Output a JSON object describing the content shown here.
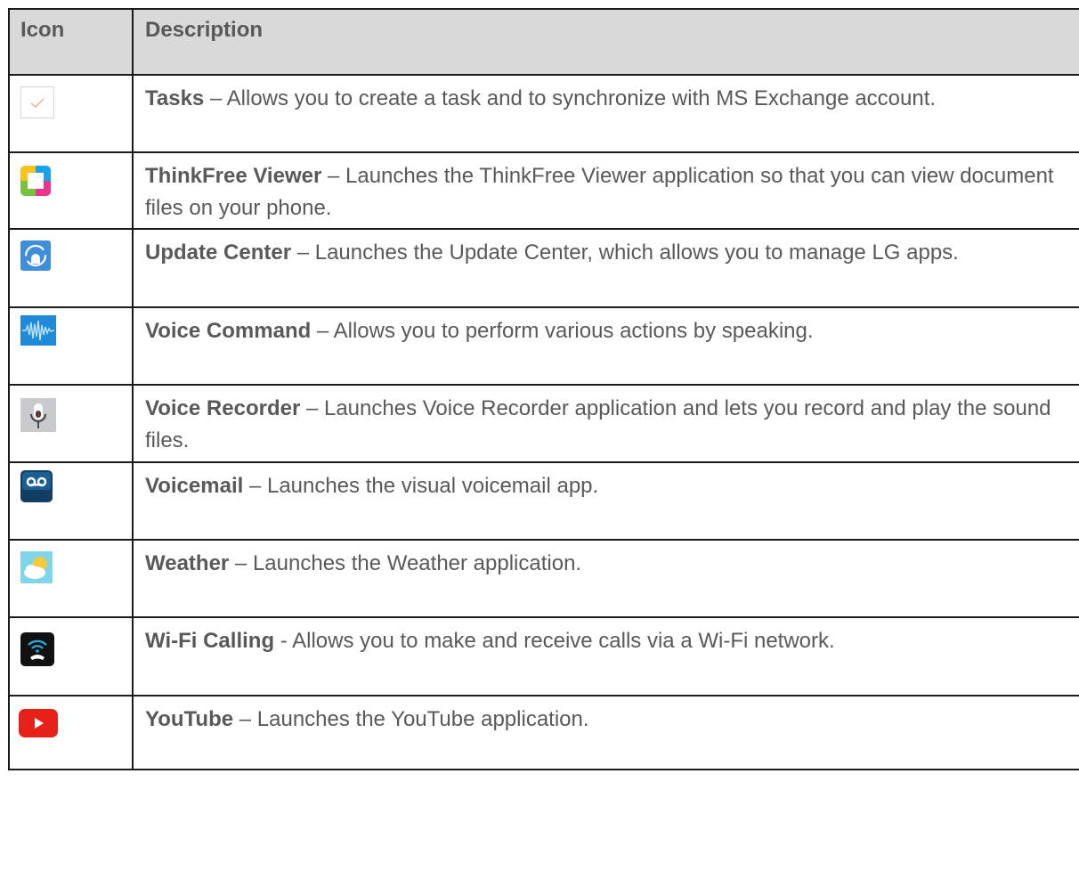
{
  "header": {
    "icon_col": "Icon",
    "desc_col": "Description"
  },
  "rows": [
    {
      "icon": "tasks-icon",
      "name": "Tasks",
      "sep": " – ",
      "text": "Allows you to create a task and to synchronize with MS Exchange account."
    },
    {
      "icon": "thinkfree-viewer-icon",
      "name": "ThinkFree Viewer",
      "sep": " – ",
      "text": "Launches the ThinkFree Viewer application so that you can view document files on your phone."
    },
    {
      "icon": "update-center-icon",
      "name": "Update Center",
      "sep": " – ",
      "text": "Launches the Update Center, which allows you to manage LG apps."
    },
    {
      "icon": "voice-command-icon",
      "name": "Voice Command",
      "sep": " – ",
      "text": "Allows you to perform various actions by speaking."
    },
    {
      "icon": "voice-recorder-icon",
      "name": "Voice Recorder",
      "sep": " – ",
      "text": "Launches Voice Recorder application and lets you record and play the sound files."
    },
    {
      "icon": "voicemail-icon",
      "name": "Voicemail",
      "sep": " – ",
      "text": "Launches the visual voicemail app."
    },
    {
      "icon": "weather-icon",
      "name": "Weather",
      "sep": " – ",
      "text": "Launches the Weather application."
    },
    {
      "icon": "wifi-calling-icon",
      "name": "Wi-Fi Calling",
      "sep": " - ",
      "text": "Allows you to make and receive calls via a Wi-Fi network."
    },
    {
      "icon": "youtube-icon",
      "name": "YouTube",
      "sep": " – ",
      "text": "Launches the YouTube application."
    }
  ]
}
